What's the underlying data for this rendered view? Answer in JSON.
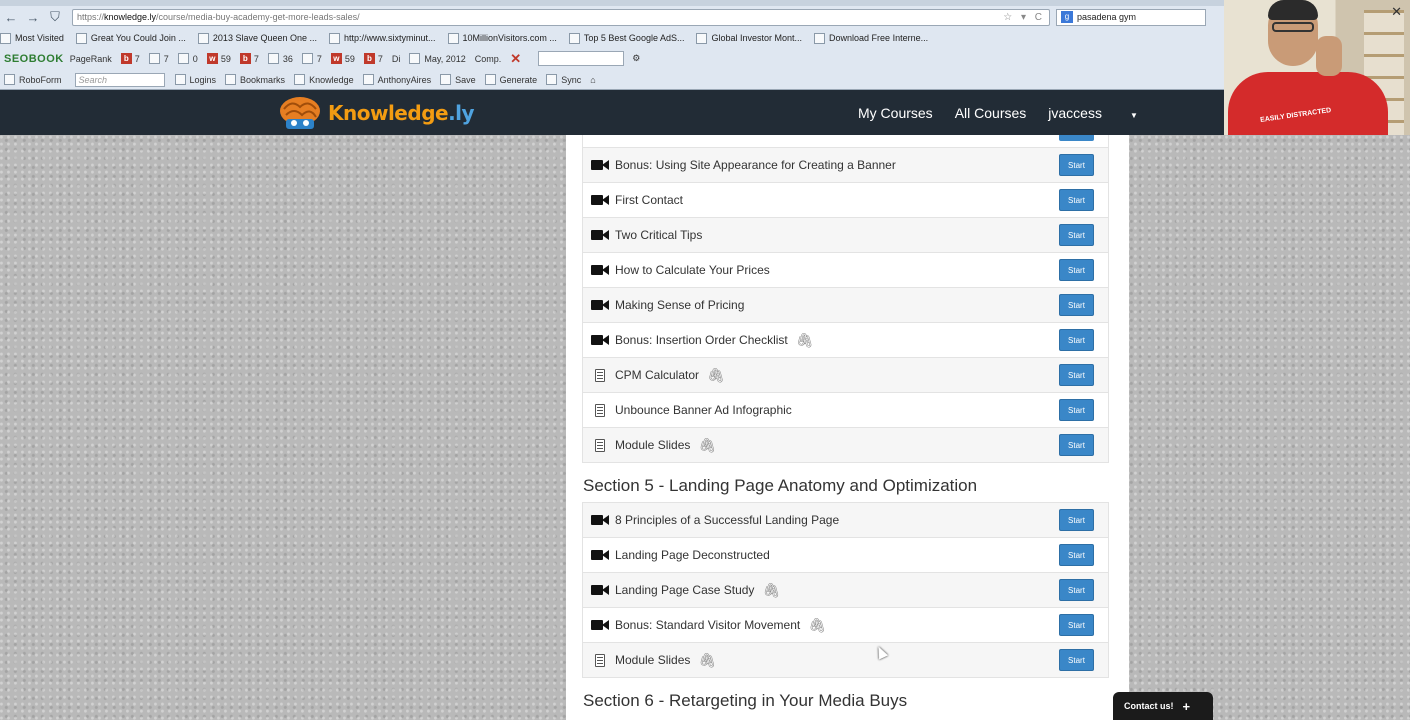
{
  "browser": {
    "url_prefix": "https://",
    "url_domain": "knowledge.ly",
    "url_path": "/course/media-buy-academy-get-more-leads-sales/",
    "url_controls": "☆ ▾ C",
    "search_value": "pasadena gym",
    "bookmarks": [
      "Most Visited",
      "Great You Could Join ...",
      "2013 Slave Queen One ...",
      "http://www.sixtyminut...",
      "10MillionVisitors.com ...",
      "Top 5 Best Google AdS...",
      "Global Investor Mont...",
      "Download Free Interne..."
    ],
    "toolbar": {
      "seobook": "SEOBOOK",
      "pagerank": "PageRank",
      "counts": [
        "7",
        "7",
        "0",
        "59",
        "7",
        "36",
        "7",
        "59",
        "7"
      ],
      "di": "Di",
      "date": "May, 2012",
      "comp": "Comp."
    },
    "toolbar2": {
      "roboform": "RoboForm",
      "search_placeholder": "Search",
      "items": [
        "Logins",
        "Bookmarks",
        "Knowledge",
        "AnthonyAires",
        "Save",
        "Generate",
        "Sync"
      ]
    }
  },
  "site": {
    "logo_main": "Knowledge",
    "logo_accent": ".ly",
    "nav": [
      "My Courses",
      "All Courses",
      "jvaccess"
    ]
  },
  "course": {
    "lessons_before": [
      {
        "title": "Bonus: Using Site Appearance for Creating a Banner",
        "type": "video",
        "attachment": false
      },
      {
        "title": "First Contact",
        "type": "video",
        "attachment": false
      },
      {
        "title": "Two Critical Tips",
        "type": "video",
        "attachment": false
      },
      {
        "title": "How to Calculate Your Prices",
        "type": "video",
        "attachment": false
      },
      {
        "title": "Making Sense of Pricing",
        "type": "video",
        "attachment": false
      },
      {
        "title": "Bonus: Insertion Order Checklist",
        "type": "video",
        "attachment": true
      },
      {
        "title": "CPM Calculator",
        "type": "document",
        "attachment": true
      },
      {
        "title": "Unbounce Banner Ad Infographic",
        "type": "document",
        "attachment": false
      },
      {
        "title": "Module Slides",
        "type": "document",
        "attachment": true
      }
    ],
    "section5": {
      "title": "Section 5 - Landing Page Anatomy and Optimization",
      "lessons": [
        {
          "title": "8 Principles of a Successful Landing Page",
          "type": "video",
          "attachment": false
        },
        {
          "title": "Landing Page Deconstructed",
          "type": "video",
          "attachment": false
        },
        {
          "title": "Landing Page Case Study",
          "type": "video",
          "attachment": true
        },
        {
          "title": "Bonus: Standard Visitor Movement",
          "type": "video",
          "attachment": true
        },
        {
          "title": "Module Slides",
          "type": "document",
          "attachment": true
        }
      ]
    },
    "section6": {
      "title": "Section 6 - Retargeting in Your Media Buys"
    },
    "start_label": "Start"
  },
  "webcam": {
    "shirt_text": "EASILY DISTRACTED"
  },
  "contact": {
    "label": "Contact us!",
    "plus": "+"
  },
  "colors": {
    "start_button": "#3a87c8",
    "navbar": "#222c36",
    "logo_orange": "#f39c12",
    "logo_blue": "#4fa3e0"
  }
}
